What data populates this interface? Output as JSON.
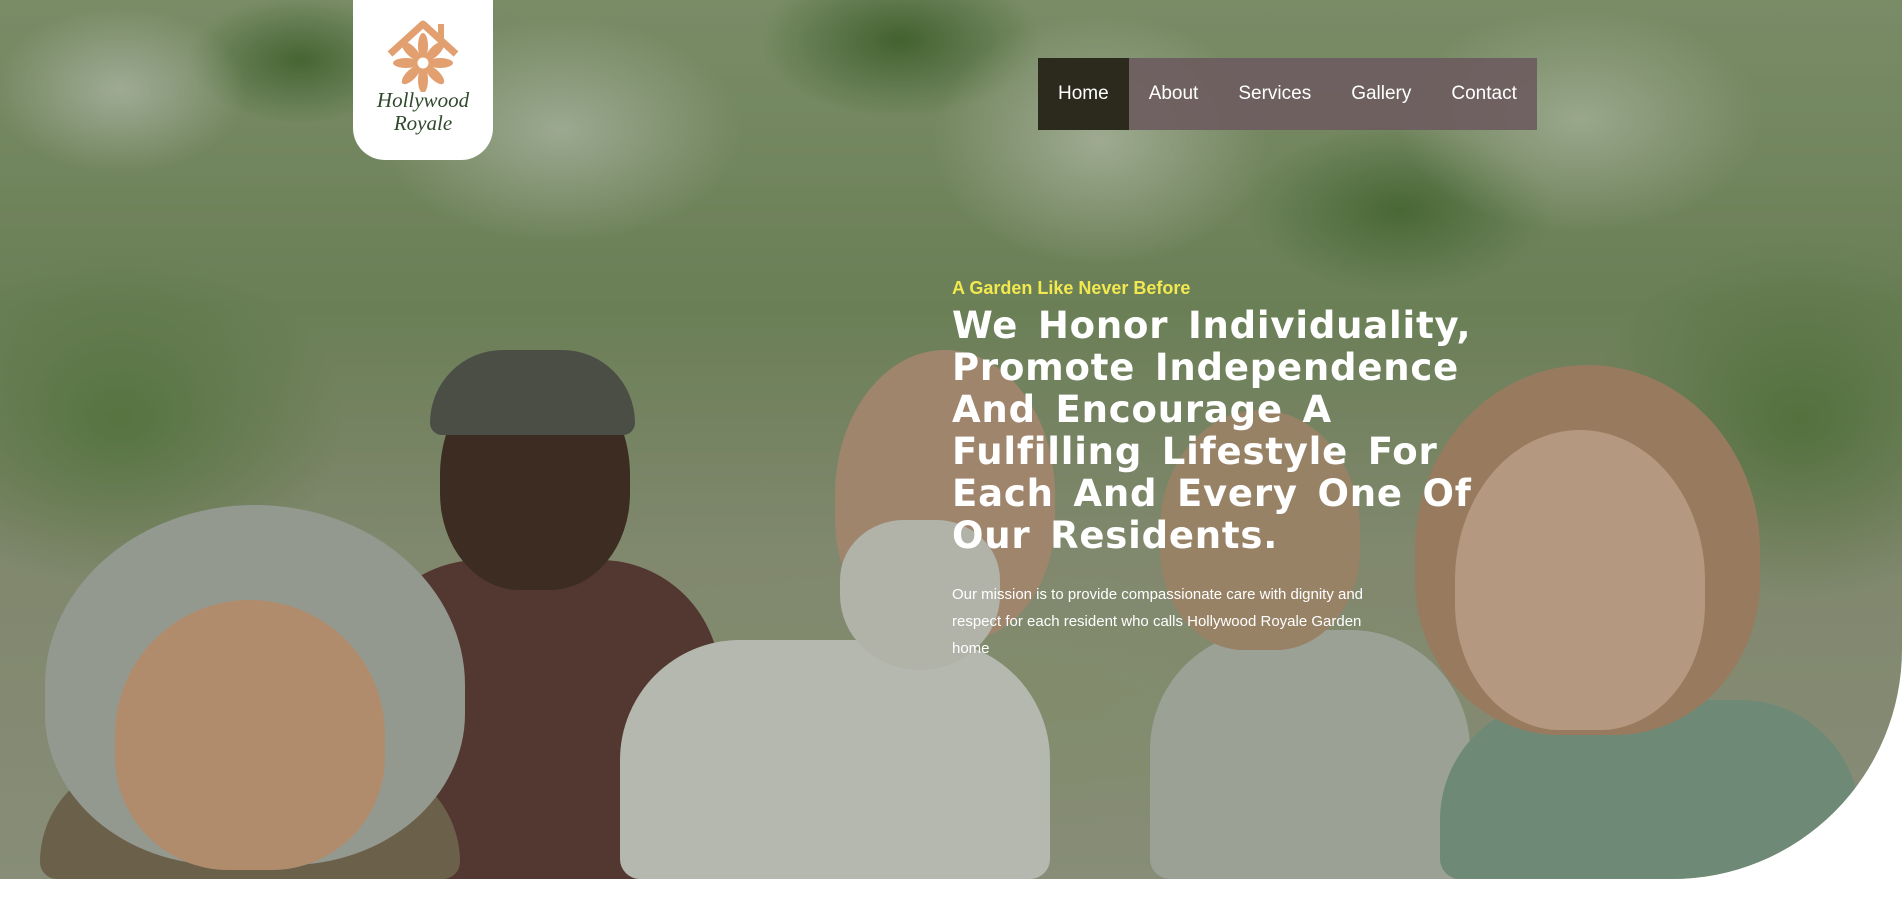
{
  "logo": {
    "line1": "Hollywood",
    "line2": "Royale",
    "icon": "house-flower-logo-icon"
  },
  "nav": {
    "items": [
      {
        "label": "Home",
        "active": true
      },
      {
        "label": "About",
        "active": false
      },
      {
        "label": "Services",
        "active": false
      },
      {
        "label": "Gallery",
        "active": false
      },
      {
        "label": "Contact",
        "active": false
      }
    ]
  },
  "hero": {
    "eyebrow": "A Garden Like Never Before",
    "headline": "We Honor Individuality, Promote Independence And Encourage A Fulfilling Lifestyle For Each And Every One Of Our Residents.",
    "mission": "Our mission is to provide compassionate care with dignity and respect for each resident who calls Hollywood Royale Garden home"
  },
  "colors": {
    "nav_background": "#6e5c60",
    "nav_active": "#2c2a1d",
    "eyebrow": "#f2e84f",
    "logo_text": "#2f4a2b",
    "logo_accent": "#e2a070"
  }
}
